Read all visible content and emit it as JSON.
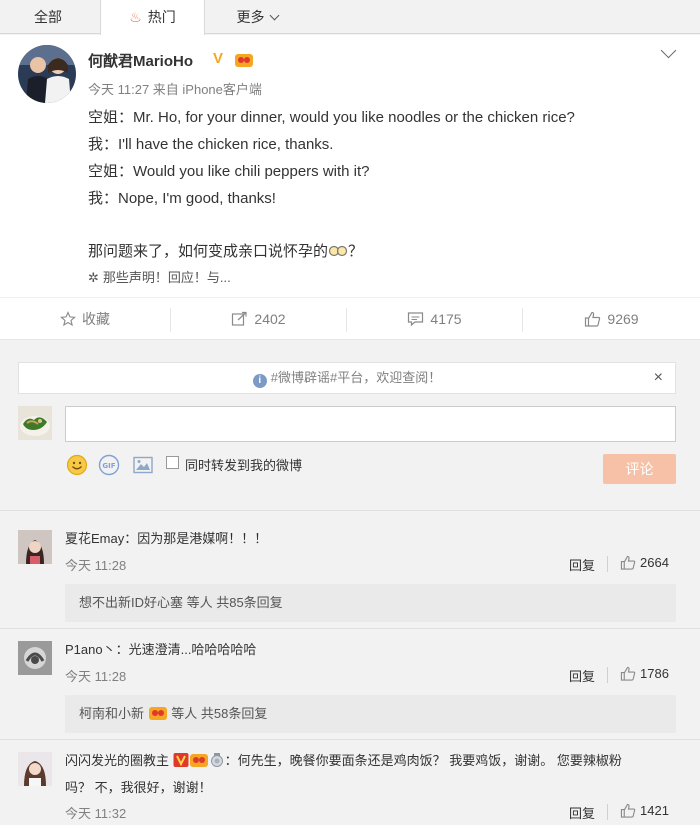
{
  "tabs": {
    "all": "全部",
    "hot": "热门",
    "more": "更多"
  },
  "post": {
    "author": "何猷君MarioHo",
    "verified_badge": "V",
    "meta": "今天 11:27 来自 iPhone客户端",
    "lines": [
      "空姐：Mr. Ho, for your dinner, would you like noodles or the chicken rice?",
      "我：I'll have the chicken rice, thanks.",
      "空姐：Would you like chili peppers with it?",
      "我：Nope, I'm good, thanks!"
    ],
    "question_prefix": "那问题来了，如何变成亲口说怀孕的",
    "question_suffix": "？",
    "more": "那些声明！回应！与..."
  },
  "actions": {
    "favorite": "收藏",
    "repost": "2402",
    "comment": "4175",
    "like": "9269"
  },
  "notice": {
    "text": "#微博辟谣#平台，欢迎查阅！",
    "close": "×"
  },
  "composer": {
    "input_value": "",
    "repost_label": "同时转发到我的微博",
    "submit": "评论",
    "submit_color": "#f7c1a7"
  },
  "comments": [
    {
      "user": "夏花Emay",
      "text": "：因为那是港媒啊！！！",
      "time": "今天 11:28",
      "reply": "回复",
      "likes": "2664",
      "replies": "想不出新ID好心塞 等人 共85条回复"
    },
    {
      "user": "P1ano丶",
      "text": "：光速澄清...哈哈哈哈哈",
      "time": "今天 11:28",
      "reply": "回复",
      "likes": "1786",
      "replies_user": "柯南和小新",
      "replies_tail": "等人 共58条回复"
    },
    {
      "user": "闪闪发光的圈教主",
      "text_line1": "：何先生，晚餐你要面条还是鸡肉饭？ 我要鸡饭，谢谢。 您要辣椒粉",
      "text_line2": "吗？ 不，我很好，谢谢！",
      "time": "今天 11:32",
      "reply": "回复",
      "likes": "1421"
    }
  ]
}
